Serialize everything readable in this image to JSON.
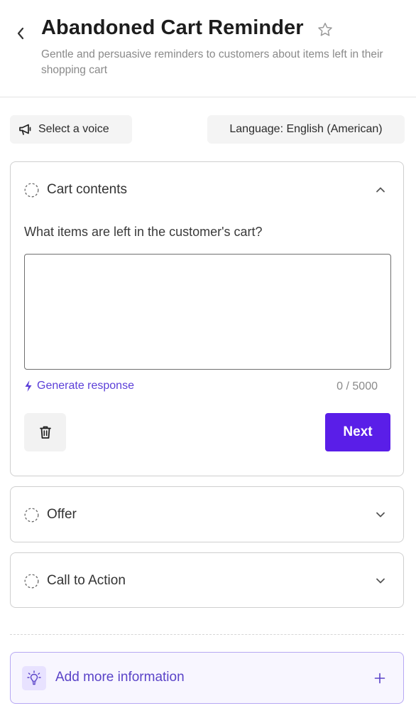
{
  "header": {
    "title": "Abandoned Cart Reminder",
    "subtitle": "Gentle and persuasive reminders to customers about items left in their shopping cart"
  },
  "toolbar": {
    "voice_label": "Select a voice",
    "language_label": "Language: English (American)"
  },
  "sections": [
    {
      "title": "Cart contents",
      "expanded": true,
      "question": "What items are left in the customer's cart?",
      "input_value": "",
      "generate_label": "Generate response",
      "counter": "0 / 5000",
      "next_label": "Next"
    },
    {
      "title": "Offer",
      "expanded": false
    },
    {
      "title": "Call to Action",
      "expanded": false
    }
  ],
  "add_more": {
    "label": "Add more information"
  },
  "colors": {
    "accent": "#5a1ee8",
    "link": "#5b3fd8",
    "add_bg": "#f8f6ff",
    "add_border": "#b7a8f3"
  },
  "icons": [
    "back-chevron-icon",
    "star-icon",
    "megaphone-icon",
    "dashed-circle-icon",
    "chevron-up-icon",
    "chevron-down-icon",
    "lightning-icon",
    "trash-icon",
    "lightbulb-icon",
    "plus-icon"
  ]
}
